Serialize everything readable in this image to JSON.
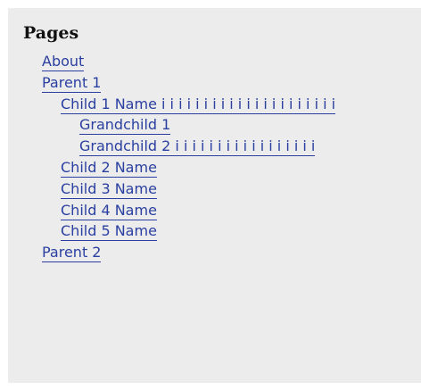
{
  "widget": {
    "title": "Pages",
    "items": {
      "about": "About",
      "parent1": "Parent 1",
      "child1": "Child 1 Name i i i i i i i i i i i i i i i i i i i i i",
      "grandchild1": "Grandchild 1",
      "grandchild2": "Grandchild 2 i i i i i i i i i i i i i i i i i",
      "child2": "Child 2 Name",
      "child3": "Child 3 Name",
      "child4": "Child 4 Name",
      "child5": "Child 5 Name",
      "parent2": "Parent 2"
    }
  },
  "colors": {
    "background": "#ececec",
    "link": "#2a3fa0",
    "heading": "#111111"
  }
}
